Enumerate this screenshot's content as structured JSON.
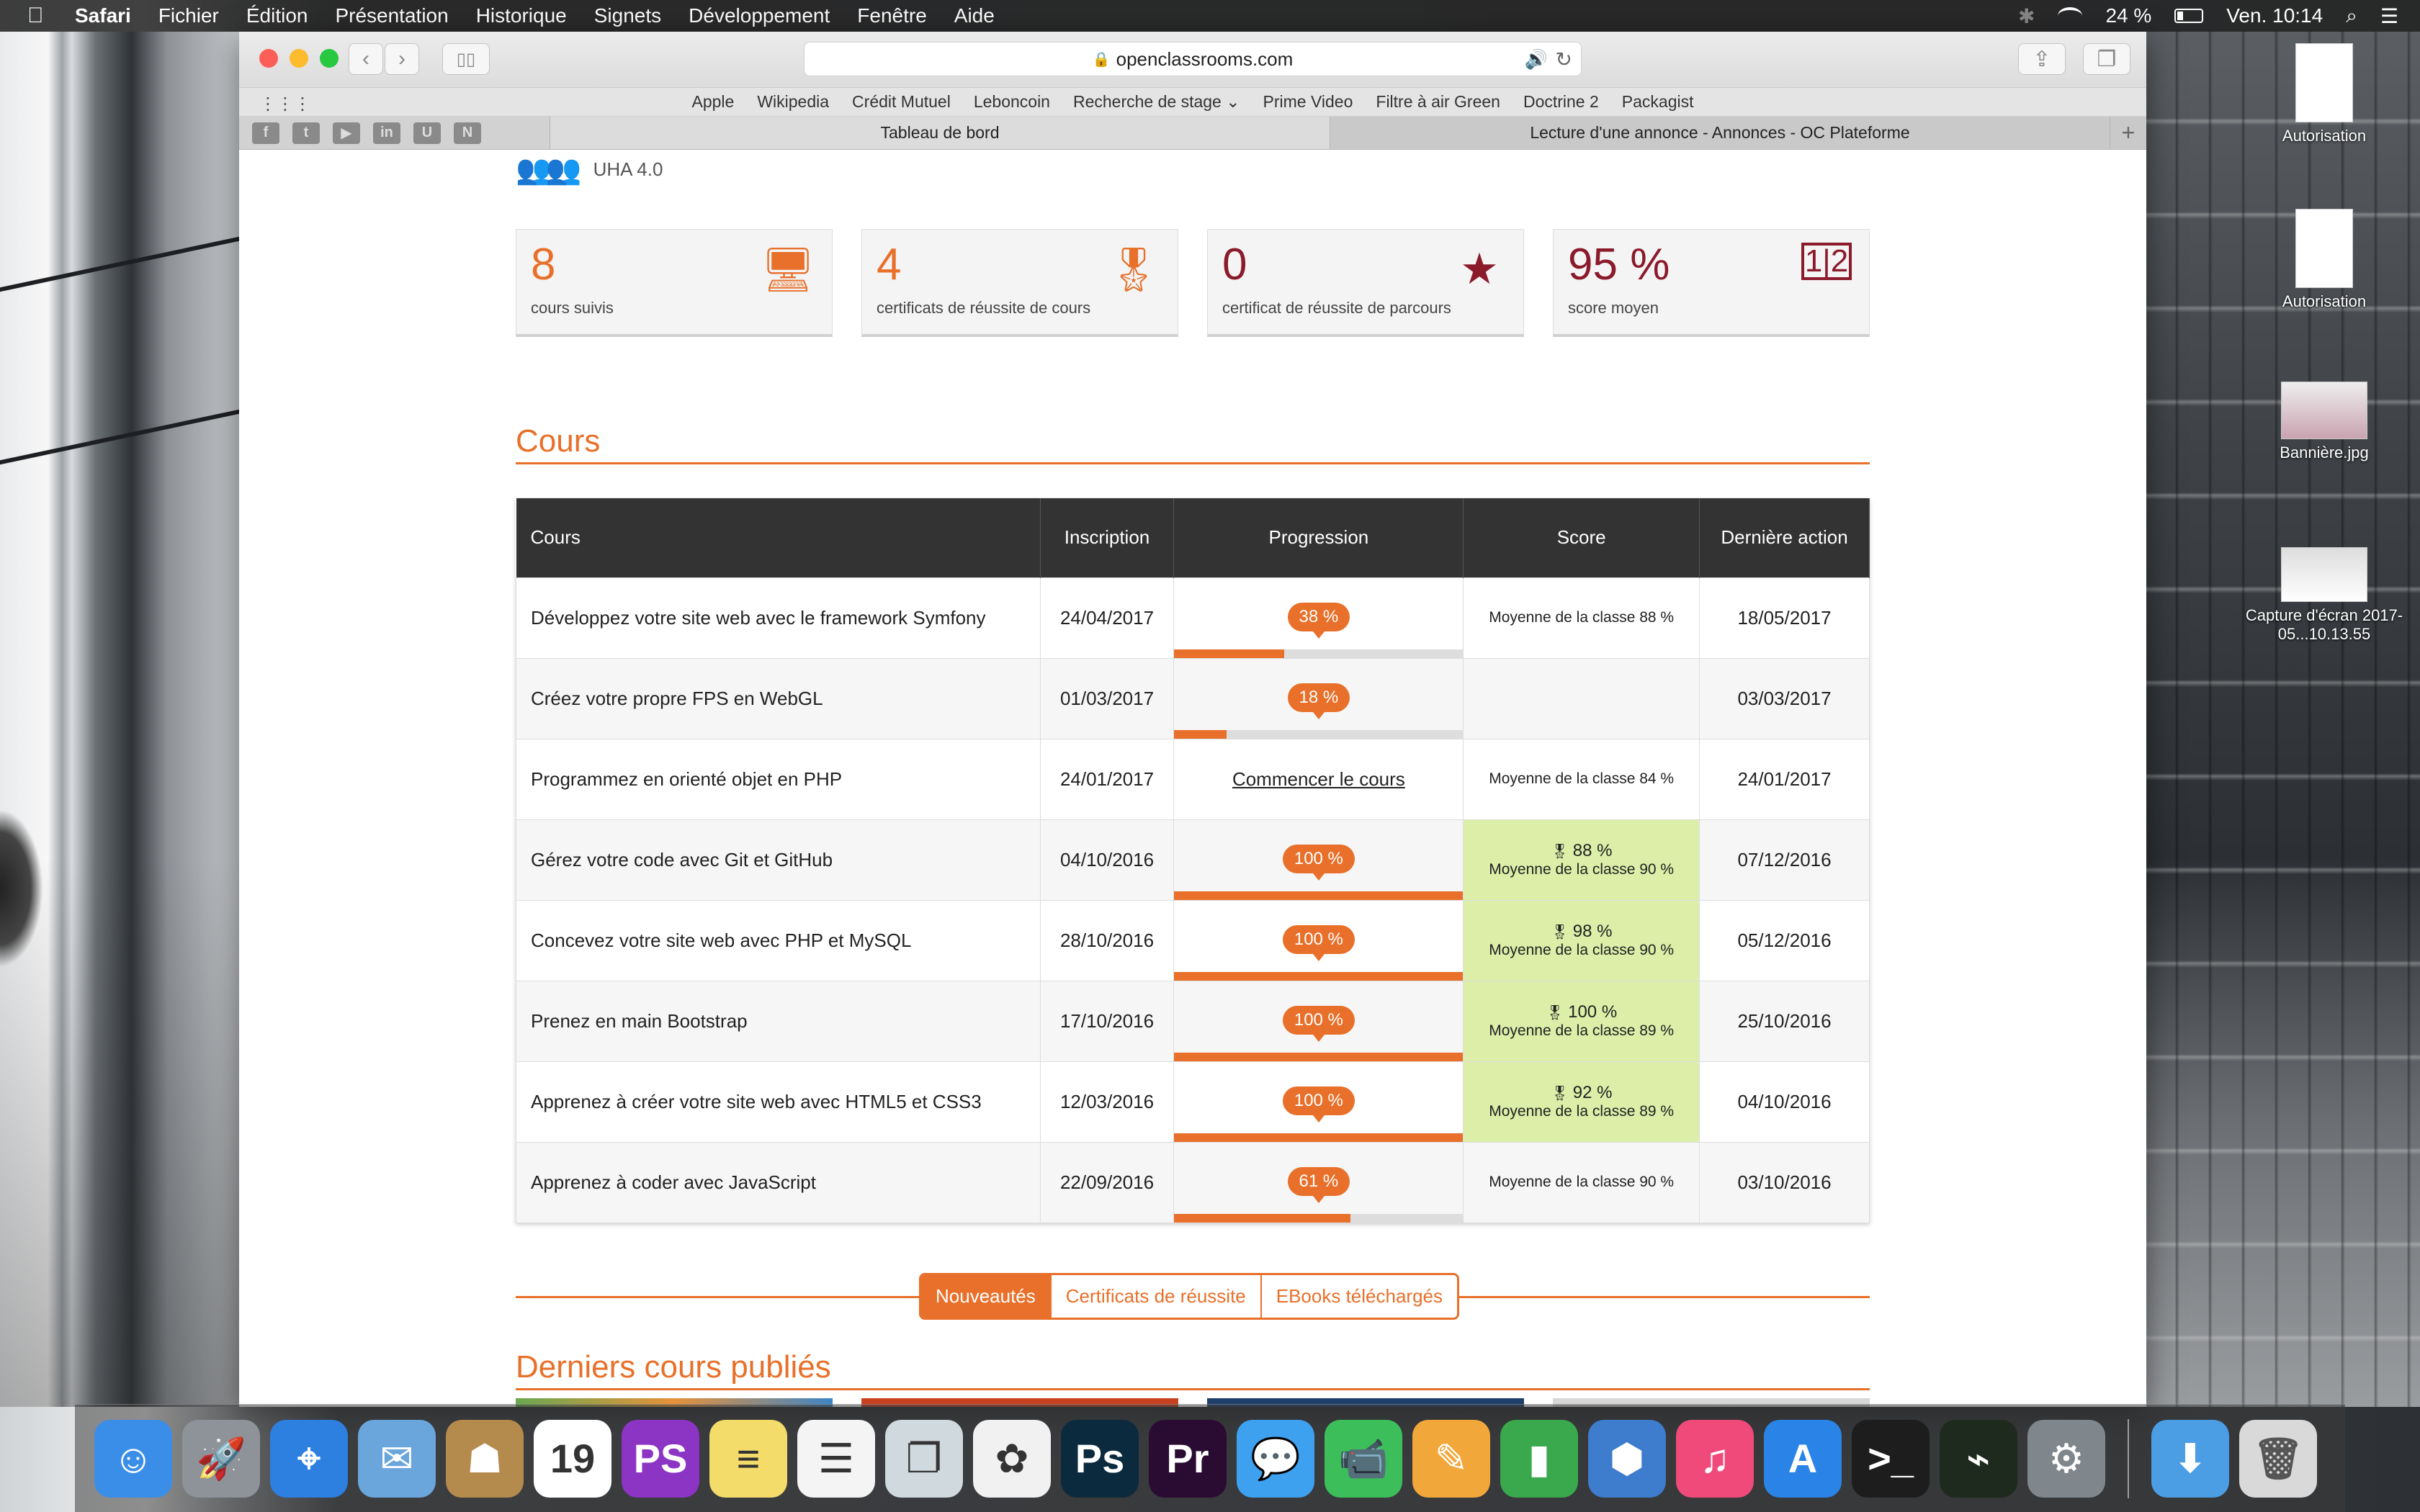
{
  "menubar": {
    "app": "Safari",
    "items": [
      "Fichier",
      "Édition",
      "Présentation",
      "Historique",
      "Signets",
      "Développement",
      "Fenêtre",
      "Aide"
    ],
    "battery": "24 %",
    "clock": "Ven. 10:14"
  },
  "browser": {
    "url": "openclassrooms.com",
    "favorites": [
      "Apple",
      "Wikipedia",
      "Crédit Mutuel",
      "Leboncoin",
      "Recherche de stage",
      "Prime Video",
      "Filtre à air Green",
      "Doctrine 2",
      "Packagist"
    ],
    "pinned_tabs": [
      "f",
      "t",
      "▶",
      "in",
      "U",
      "N"
    ],
    "tabs": [
      "Tableau de bord",
      "Lecture d'une annonce - Annonces - OC Plateforme"
    ]
  },
  "page": {
    "group_label": "UHA 4.0",
    "stats": [
      {
        "value": "8",
        "label": "cours suivis",
        "color": "#e8702a",
        "icon": "monitor-icon"
      },
      {
        "value": "4",
        "label": "certificats de réussite de cours",
        "color": "#e8702a",
        "icon": "ribbon-icon"
      },
      {
        "value": "0",
        "label": "certificat de réussite de parcours",
        "color": "#8b1a2b",
        "icon": "star-badge-icon"
      },
      {
        "value": "95 %",
        "label": "score moyen",
        "color": "#8b1a2b",
        "icon": "score-icon"
      }
    ],
    "cours_title": "Cours",
    "table": {
      "headers": [
        "Cours",
        "Inscription",
        "Progression",
        "Score",
        "Dernière action"
      ],
      "rows": [
        {
          "course": "Développez votre site web avec le framework Symfony",
          "inscription": "24/04/2017",
          "progress_label": "38 %",
          "progress": 0.38,
          "score_top": "",
          "score_bottom": "Moyenne de la classe 88 %",
          "completed": false,
          "last": "18/05/2017"
        },
        {
          "course": "Créez votre propre FPS en WebGL",
          "inscription": "01/03/2017",
          "progress_label": "18 %",
          "progress": 0.18,
          "score_top": "",
          "score_bottom": "",
          "completed": false,
          "last": "03/03/2017"
        },
        {
          "course": "Programmez en orienté objet en PHP",
          "inscription": "24/01/2017",
          "progress_label": "Commencer le cours",
          "progress": null,
          "score_top": "",
          "score_bottom": "Moyenne de la classe 84 %",
          "completed": false,
          "last": "24/01/2017"
        },
        {
          "course": "Gérez votre code avec Git et GitHub",
          "inscription": "04/10/2016",
          "progress_label": "100 %",
          "progress": 1.0,
          "score_top": "88 %",
          "score_bottom": "Moyenne de la classe 90 %",
          "completed": true,
          "last": "07/12/2016"
        },
        {
          "course": "Concevez votre site web avec PHP et MySQL",
          "inscription": "28/10/2016",
          "progress_label": "100 %",
          "progress": 1.0,
          "score_top": "98 %",
          "score_bottom": "Moyenne de la classe 90 %",
          "completed": true,
          "last": "05/12/2016"
        },
        {
          "course": "Prenez en main Bootstrap",
          "inscription": "17/10/2016",
          "progress_label": "100 %",
          "progress": 1.0,
          "score_top": "100 %",
          "score_bottom": "Moyenne de la classe 89 %",
          "completed": true,
          "last": "25/10/2016"
        },
        {
          "course": "Apprenez à créer votre site web avec HTML5 et CSS3",
          "inscription": "12/03/2016",
          "progress_label": "100 %",
          "progress": 1.0,
          "score_top": "92 %",
          "score_bottom": "Moyenne de la classe 89 %",
          "completed": true,
          "last": "04/10/2016"
        },
        {
          "course": "Apprenez à coder avec JavaScript",
          "inscription": "22/09/2016",
          "progress_label": "61 %",
          "progress": 0.61,
          "score_top": "",
          "score_bottom": "Moyenne de la classe 90 %",
          "completed": false,
          "last": "03/10/2016"
        }
      ]
    },
    "tabs_nav": [
      "Nouveautés",
      "Certificats de réussite",
      "EBooks téléchargés"
    ],
    "latest_title": "Derniers cours publiés"
  },
  "desktop": {
    "icons": [
      "Autorisation",
      "Autorisation",
      "Bannière.jpg",
      "Capture d'écran 2017-05...10.13.55"
    ]
  },
  "dock": {
    "items": [
      {
        "name": "finder-icon",
        "color": "#3b8ee8",
        "glyph": "☺"
      },
      {
        "name": "launchpad-icon",
        "color": "#8d9399",
        "glyph": "🚀"
      },
      {
        "name": "safari-icon",
        "color": "#2d7fe0",
        "glyph": "⌖"
      },
      {
        "name": "mail-icon",
        "color": "#6aa6dc",
        "glyph": "✉"
      },
      {
        "name": "contacts-icon",
        "color": "#b58a4d",
        "glyph": "☗"
      },
      {
        "name": "calendar-icon",
        "color": "#ffffff",
        "glyph": "19"
      },
      {
        "name": "phpstorm-icon",
        "color": "#8c34c4",
        "glyph": "PS"
      },
      {
        "name": "notes-icon",
        "color": "#f4dc6b",
        "glyph": "≡"
      },
      {
        "name": "reminders-icon",
        "color": "#f4f4f4",
        "glyph": "☰"
      },
      {
        "name": "preview-icon",
        "color": "#d0d9dd",
        "glyph": "❐"
      },
      {
        "name": "photos-icon",
        "color": "#f1f1f1",
        "glyph": "✿"
      },
      {
        "name": "photoshop-icon",
        "color": "#0c2a3d",
        "glyph": "Ps"
      },
      {
        "name": "premiere-icon",
        "color": "#2a0c33",
        "glyph": "Pr"
      },
      {
        "name": "messages-icon",
        "color": "#3ea1ef",
        "glyph": "💬"
      },
      {
        "name": "facetime-icon",
        "color": "#3cbf5a",
        "glyph": "📹"
      },
      {
        "name": "pages-icon",
        "color": "#f2a73a",
        "glyph": "✎"
      },
      {
        "name": "numbers-icon",
        "color": "#3aa94d",
        "glyph": "▮"
      },
      {
        "name": "keynote-icon",
        "color": "#3e7ccd",
        "glyph": "⬢"
      },
      {
        "name": "itunes-icon",
        "color": "#f04a7b",
        "glyph": "♫"
      },
      {
        "name": "appstore-icon",
        "color": "#2a84e8",
        "glyph": "A"
      },
      {
        "name": "terminal-icon",
        "color": "#1d1d1d",
        "glyph": ">_"
      },
      {
        "name": "activity-monitor-icon",
        "color": "#1f2a1f",
        "glyph": "⌁"
      },
      {
        "name": "system-preferences-icon",
        "color": "#7f868c",
        "glyph": "⚙"
      }
    ],
    "right_items": [
      {
        "name": "downloads-icon",
        "color": "#4b9de4",
        "glyph": "⬇"
      },
      {
        "name": "trash-icon",
        "color": "#d9d9d9",
        "glyph": "🗑"
      }
    ]
  }
}
